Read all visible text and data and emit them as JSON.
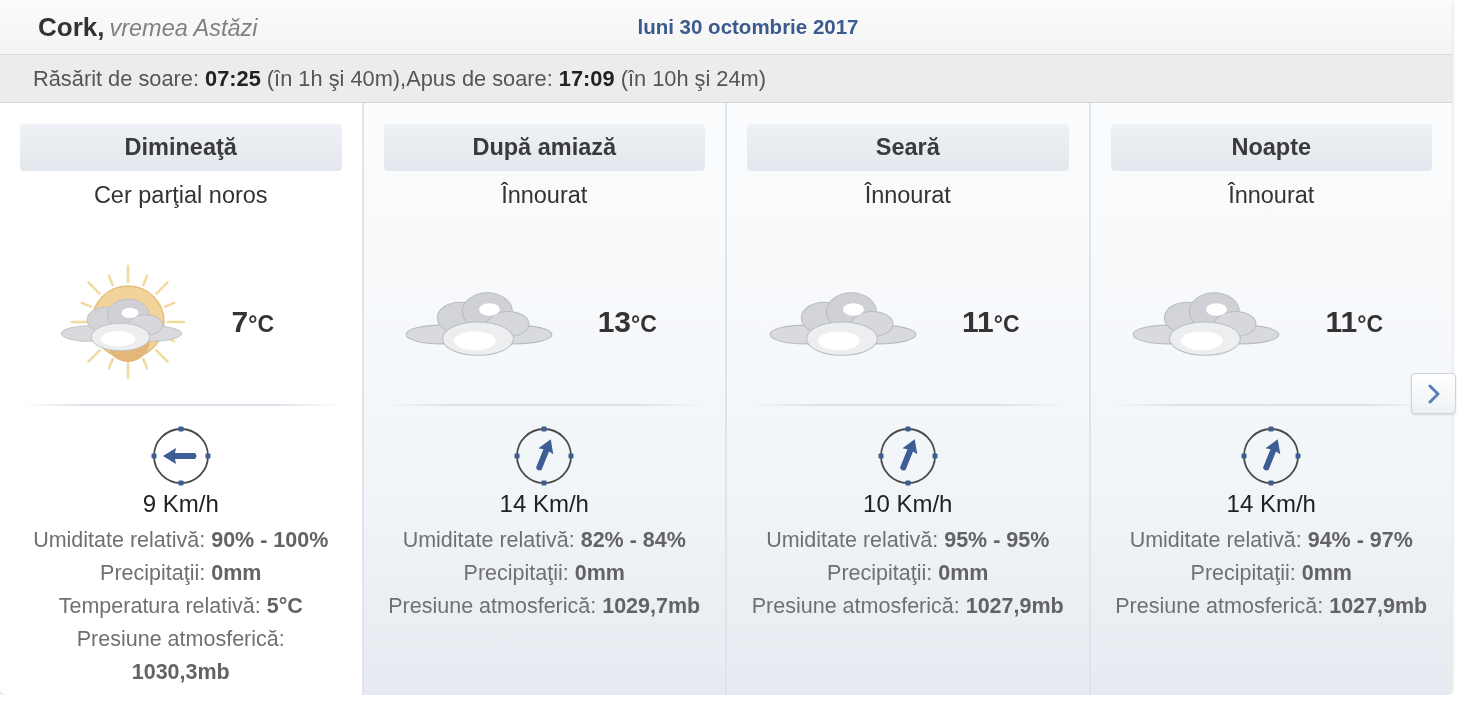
{
  "header": {
    "city": "Cork,",
    "subtitle": "vremea Astăzi",
    "date": "luni 30 octombrie 2017"
  },
  "sun_info": "Răsărit de soare: **07:25** (în 1h şi 40m),Apus de soare: **17:09** (în 10h şi 24m)",
  "periods": [
    {
      "name": "Dimineaţă",
      "selected": true,
      "condition": "Cer parţial noros",
      "kind": "partly_cloudy",
      "temperature": "7",
      "unit": "°C",
      "wind": {
        "kind": "west",
        "speed": "9 Km/h"
      },
      "details": [
        "Umiditate relativă: **90% - 100%**",
        "Precipitaţii: **0mm**",
        "Temperatura relativă: **5°C**",
        "Presiune atmosferică: **1030,3mb**"
      ]
    },
    {
      "name": "După amiază",
      "selected": false,
      "condition": "Înnourat",
      "kind": "cloudy",
      "temperature": "13",
      "unit": "°C",
      "wind": {
        "kind": "northeast",
        "speed": "14 Km/h"
      },
      "details": [
        "Umiditate relativă: **82% - 84%**",
        "Precipitaţii: **0mm**",
        "Presiune atmosferică: **1029,7mb**"
      ]
    },
    {
      "name": "Seară",
      "selected": false,
      "condition": "Înnourat",
      "kind": "cloudy",
      "temperature": "11",
      "unit": "°C",
      "wind": {
        "kind": "northeast",
        "speed": "10 Km/h"
      },
      "details": [
        "Umiditate relativă: **95% - 95%**",
        "Precipitaţii: **0mm**",
        "Presiune atmosferică: **1027,9mb**"
      ]
    },
    {
      "name": "Noapte",
      "selected": false,
      "condition": "Înnourat",
      "kind": "cloudy",
      "temperature": "11",
      "unit": "°C",
      "wind": {
        "kind": "northeast",
        "speed": "14 Km/h"
      },
      "details": [
        "Umiditate relativă: **94% - 97%**",
        "Precipitaţii: **0mm**",
        "Presiune atmosferică: **1027,9mb**"
      ]
    }
  ]
}
